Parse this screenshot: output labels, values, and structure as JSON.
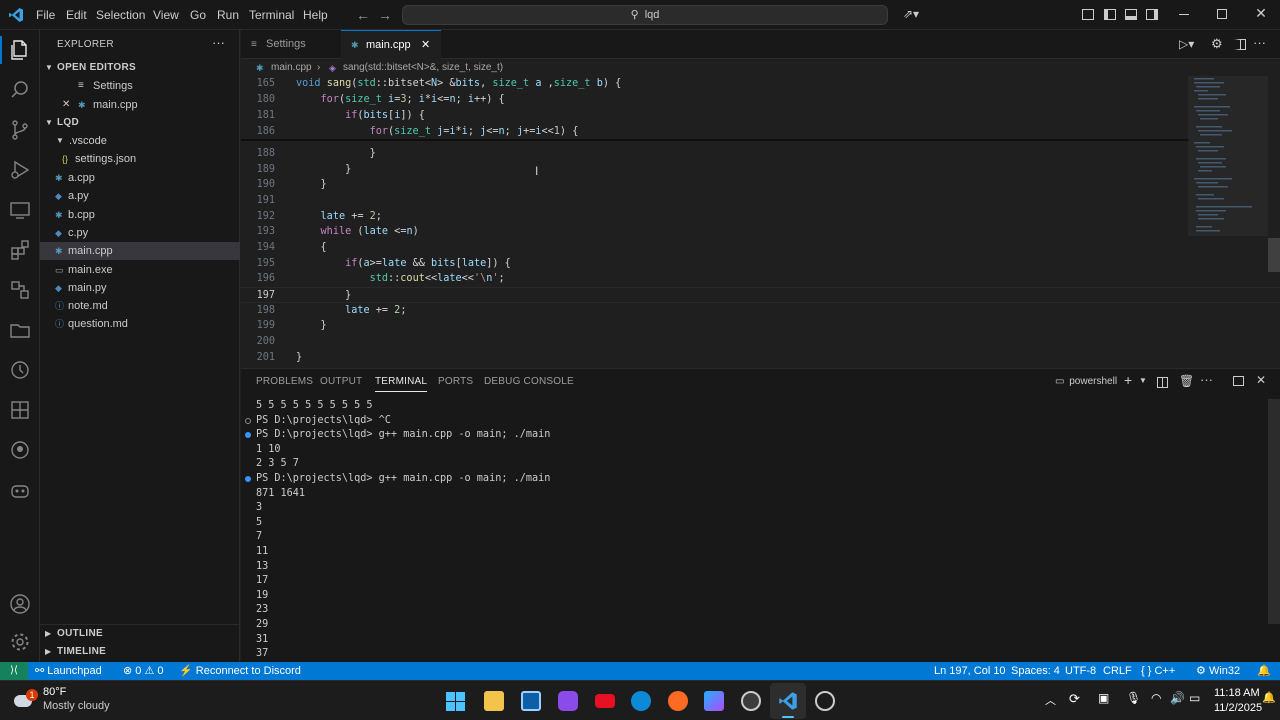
{
  "titlebar": {
    "menu": [
      "File",
      "Edit",
      "Selection",
      "View",
      "Go",
      "Run",
      "Terminal",
      "Help"
    ],
    "search": "lqd"
  },
  "explorer": {
    "title": "EXPLORER",
    "open_editors_label": "OPEN EDITORS",
    "open_editors": [
      "Settings",
      "main.cpp"
    ],
    "project_label": "LQD",
    "folder": ".vscode",
    "folder_files": [
      "settings.json"
    ],
    "files": [
      "a.cpp",
      "a.py",
      "b.cpp",
      "c.py",
      "main.cpp",
      "main.exe",
      "main.py",
      "note.md",
      "question.md"
    ],
    "outline_label": "OUTLINE",
    "timeline_label": "TIMELINE"
  },
  "tabs": [
    {
      "label": "Settings",
      "icon": "settings-icon"
    },
    {
      "label": "main.cpp",
      "icon": "cpp-file-icon"
    }
  ],
  "breadcrumb": {
    "file": "main.cpp",
    "symbol": "sang(std::bitset<N>&, size_t, size_t)"
  },
  "editor": {
    "cursor_line": "197",
    "lines": [
      {
        "n": "165",
        "t": "void sang(std::bitset<N> &bits, size_t a ,size_t b) {"
      },
      {
        "n": "180",
        "t": "    for(size_t i=3; i*i<=n; i++) {"
      },
      {
        "n": "181",
        "t": "        if(bits[i]) {"
      },
      {
        "n": "186",
        "t": "            for(size_t j=i*i; j<=n; j+=i<<1) {"
      },
      {
        "n": "188",
        "t": "            }"
      },
      {
        "n": "189",
        "t": "        }"
      },
      {
        "n": "190",
        "t": "    }"
      },
      {
        "n": "191",
        "t": ""
      },
      {
        "n": "192",
        "t": "    late += 2;"
      },
      {
        "n": "193",
        "t": "    while (late <=n)"
      },
      {
        "n": "194",
        "t": "    {"
      },
      {
        "n": "195",
        "t": "        if(a>=late && bits[late]) {"
      },
      {
        "n": "196",
        "t": "            std::cout<<late<<'\\n';"
      },
      {
        "n": "197",
        "t": "        }"
      },
      {
        "n": "198",
        "t": "        late += 2;"
      },
      {
        "n": "199",
        "t": "    }"
      },
      {
        "n": "200",
        "t": ""
      },
      {
        "n": "201",
        "t": "}"
      }
    ]
  },
  "panel": {
    "tabs": [
      "PROBLEMS",
      "OUTPUT",
      "TERMINAL",
      "PORTS",
      "DEBUG CONSOLE"
    ],
    "active_tab": "TERMINAL",
    "shell": "powershell",
    "terminal_lines": [
      "5 5 5 5 5 5 5 5 5 5",
      "PS D:\\projects\\lqd> ^C",
      "PS D:\\projects\\lqd> g++ main.cpp -o main; ./main",
      "1 10",
      "2 3 5 7",
      "PS D:\\projects\\lqd> g++ main.cpp -o main; ./main",
      "871 1641",
      "3",
      "5",
      "7",
      "11",
      "13",
      "17",
      "19",
      "23",
      "29",
      "31",
      "37"
    ]
  },
  "statusbar": {
    "launchpad": "Launchpad",
    "problems": "0",
    "warnings": "0",
    "discord": "Reconnect to Discord",
    "position": "Ln 197, Col 10",
    "spaces": "Spaces: 4",
    "encoding": "UTF-8",
    "eol": "CRLF",
    "language": "C++",
    "platform": "Win32"
  },
  "taskbar": {
    "weather_temp": "80°F",
    "weather_desc": "Mostly cloudy",
    "weather_badge": "1",
    "time": "11:18 AM",
    "date": "11/2/2025"
  },
  "colors": {
    "accent": "#0078d4",
    "bg": "#1f1f1f",
    "sidebar": "#181818"
  }
}
